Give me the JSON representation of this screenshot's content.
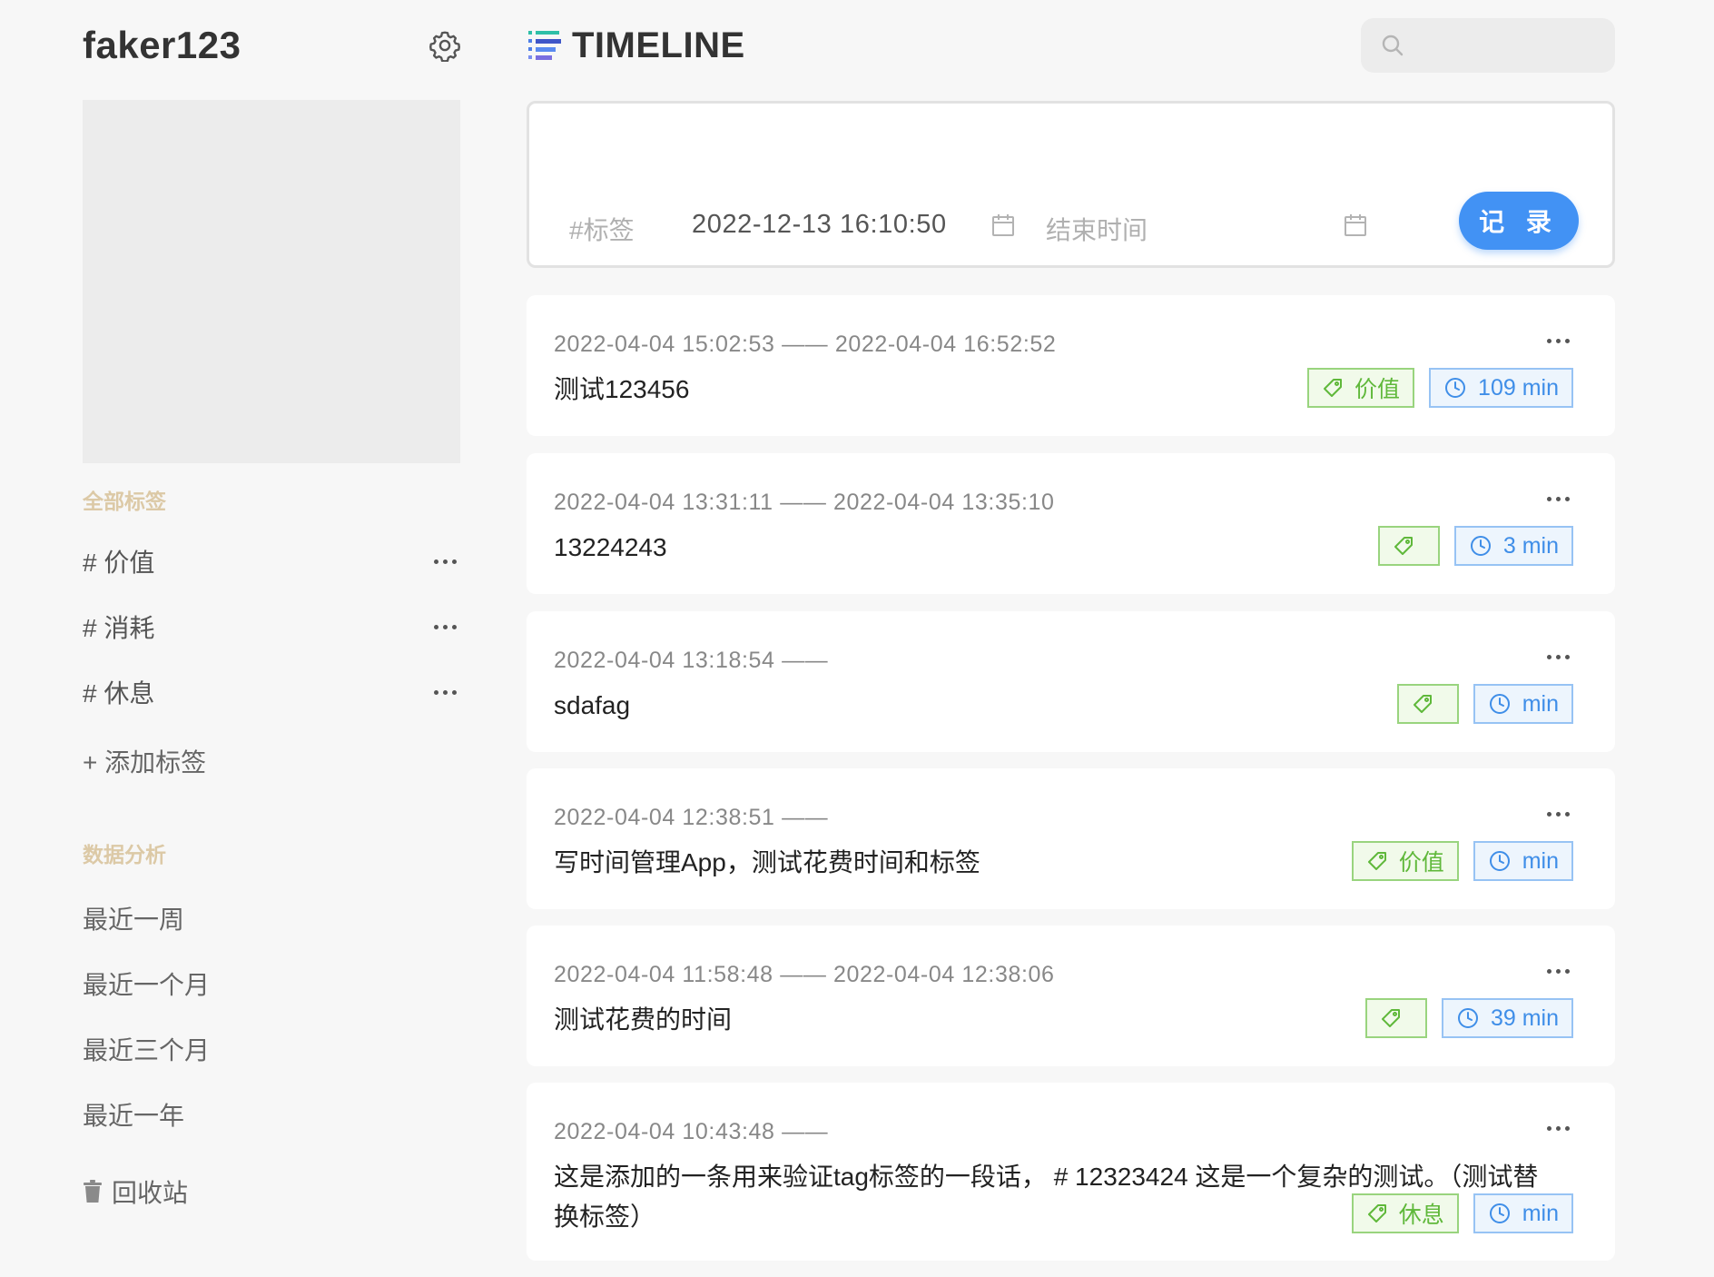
{
  "sidebar": {
    "username": "faker123",
    "tags_section_title": "全部标签",
    "tags": [
      {
        "label": "# 价值"
      },
      {
        "label": "# 消耗"
      },
      {
        "label": "# 休息"
      }
    ],
    "add_tag_label": "+ 添加标签",
    "analysis_section_title": "数据分析",
    "analysis_links": [
      {
        "label": "最近一周"
      },
      {
        "label": "最近一个月"
      },
      {
        "label": "最近三个月"
      },
      {
        "label": "最近一年"
      }
    ],
    "trash_label": "回收站"
  },
  "header": {
    "title": "TIMELINE",
    "search_placeholder": ""
  },
  "composer": {
    "tag_placeholder": "#标签",
    "start_time": "2022-12-13 16:10:50",
    "end_time_placeholder": "结束时间",
    "record_button": "记 录"
  },
  "entries": [
    {
      "time": "2022-04-04 15:02:53 —— 2022-04-04 16:52:52",
      "content": "测试123456",
      "tag": "价值",
      "duration": "109 min"
    },
    {
      "time": "2022-04-04 13:31:11 —— 2022-04-04 13:35:10",
      "content": "13224243",
      "tag": "",
      "duration": "3 min"
    },
    {
      "time": "2022-04-04 13:18:54 ——",
      "content": "sdafag",
      "tag": "",
      "duration": "min"
    },
    {
      "time": "2022-04-04 12:38:51 ——",
      "content": "写时间管理App，测试花费时间和标签",
      "tag": "价值",
      "duration": "min"
    },
    {
      "time": "2022-04-04 11:58:48 —— 2022-04-04 12:38:06",
      "content": "测试花费的时间",
      "tag": "",
      "duration": "39 min"
    },
    {
      "time": "2022-04-04 10:43:48 ——",
      "content_line1": "这是添加的一条用来验证tag标签的一段话， # 12323424 这是一个复杂的测试。（测试替",
      "content_line2": "换标签）",
      "tag": "休息",
      "duration": "min"
    }
  ],
  "colors": {
    "accent_blue": "#4292f4",
    "tag_green": "#5fb83a",
    "section_title": "#dcc9a6",
    "background": "#f7f7f7"
  },
  "icons": [
    "gear-icon",
    "timeline-logo-icon",
    "search-icon",
    "calendar-icon",
    "tag-icon",
    "clock-icon",
    "more-icon",
    "trash-icon"
  ]
}
